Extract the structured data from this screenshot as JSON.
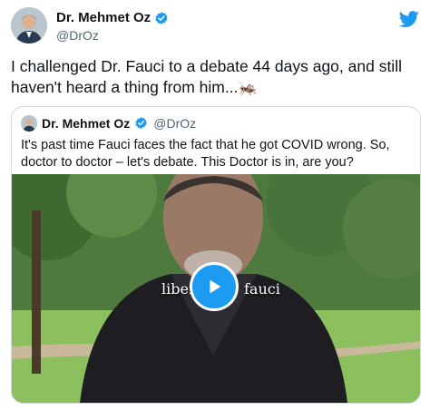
{
  "author": {
    "name": "Dr. Mehmet Oz",
    "handle": "@DrOz"
  },
  "tweet": {
    "text": "I challenged Dr. Fauci to a debate 44 days ago, and still haven't heard a thing from him...🦗"
  },
  "quoted": {
    "name": "Dr. Mehmet Oz",
    "handle": "@DrOz",
    "text": "It's past time Fauci faces the fact that he got COVID wrong. So, doctor to doctor – let's debate. This Doctor is in, are you?",
    "video_caption_left": "liber",
    "video_caption_right": "fauci"
  },
  "icons": {
    "verified": "verified-badge-icon",
    "brand": "twitter-bird-icon",
    "play": "play-icon"
  },
  "colors": {
    "accent": "#1d9bf0",
    "text": "#0f1419",
    "muted": "#536471",
    "border": "#cfd9de"
  }
}
